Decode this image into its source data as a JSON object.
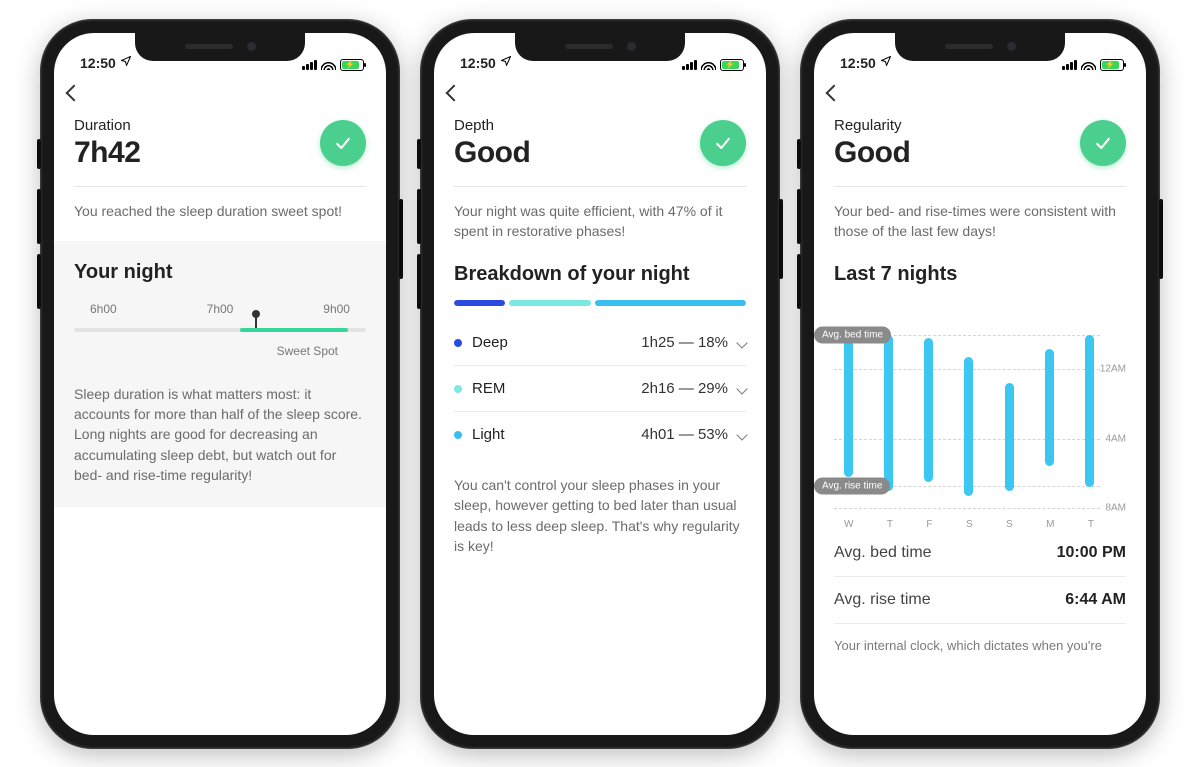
{
  "statusbar": {
    "time": "12:50"
  },
  "phones": {
    "duration": {
      "eyebrow": "Duration",
      "value": "7h42",
      "summary": "You reached the sleep duration sweet spot!",
      "section_title": "Your night",
      "ticks": [
        "6h00",
        "7h00",
        "9h00"
      ],
      "sweet_spot_label": "Sweet Spot",
      "explain": "Sleep duration is what matters most: it accounts for more than half of the sleep score. Long nights are good for decreasing an accumulating sleep debt, but watch out for bed- and rise-time regularity!"
    },
    "depth": {
      "eyebrow": "Depth",
      "value": "Good",
      "summary": "Your night was quite efficient, with 47% of it spent in restorative phases!",
      "section_title": "Breakdown of your night",
      "phases": [
        {
          "name": "Deep",
          "time": "1h25",
          "pct": "18%",
          "color": "#2b4be0"
        },
        {
          "name": "REM",
          "time": "2h16",
          "pct": "29%",
          "color": "#7be9e1"
        },
        {
          "name": "Light",
          "time": "4h01",
          "pct": "53%",
          "color": "#38bff0"
        }
      ],
      "explain": "You can't control your sleep phases in your sleep, however getting to bed later than usual leads to less deep sleep. That's why regularity is key!"
    },
    "regularity": {
      "eyebrow": "Regularity",
      "value": "Good",
      "summary": "Your bed- and rise-times were consistent with those of the last few days!",
      "section_title": "Last 7 nights",
      "pill_bed": "Avg. bed time",
      "pill_rise": "Avg. rise time",
      "axis": [
        "12AM",
        "4AM",
        "8AM"
      ],
      "days": [
        "W",
        "T",
        "F",
        "S",
        "S",
        "M",
        "T"
      ],
      "avg_bed_label": "Avg. bed time",
      "avg_bed_value": "10:00 PM",
      "avg_rise_label": "Avg. rise time",
      "avg_rise_value": "6:44 AM",
      "cutoff": "Your internal clock, which dictates when you're"
    }
  },
  "chart_data": [
    {
      "type": "bar",
      "id": "depth_breakdown",
      "title": "Breakdown of your night",
      "categories": [
        "Deep",
        "REM",
        "Light"
      ],
      "series": [
        {
          "name": "duration",
          "values": [
            "1h25",
            "2h16",
            "4h01"
          ]
        },
        {
          "name": "percent",
          "values": [
            18,
            29,
            53
          ]
        }
      ]
    },
    {
      "type": "bar",
      "id": "regularity_7_nights",
      "title": "Last 7 nights",
      "categories": [
        "W",
        "T",
        "F",
        "S",
        "S",
        "M",
        "T"
      ],
      "ylabel": "time of day",
      "ylim_hours_from_8pm": [
        0,
        12
      ],
      "series": [
        {
          "name": "bed_time_hours_from_8pm",
          "values": [
            1.6,
            2.0,
            2.2,
            3.3,
            4.8,
            2.8,
            2.0
          ]
        },
        {
          "name": "rise_time_hours_from_8pm",
          "values": [
            10.2,
            11.0,
            10.5,
            11.3,
            11.0,
            9.6,
            10.8
          ]
        }
      ],
      "reference_lines": {
        "avg_bed_time": 2.0,
        "avg_rise_time": 10.7
      },
      "axis_ticks": {
        "12AM": 4,
        "4AM": 8,
        "8AM": 12
      }
    }
  ]
}
